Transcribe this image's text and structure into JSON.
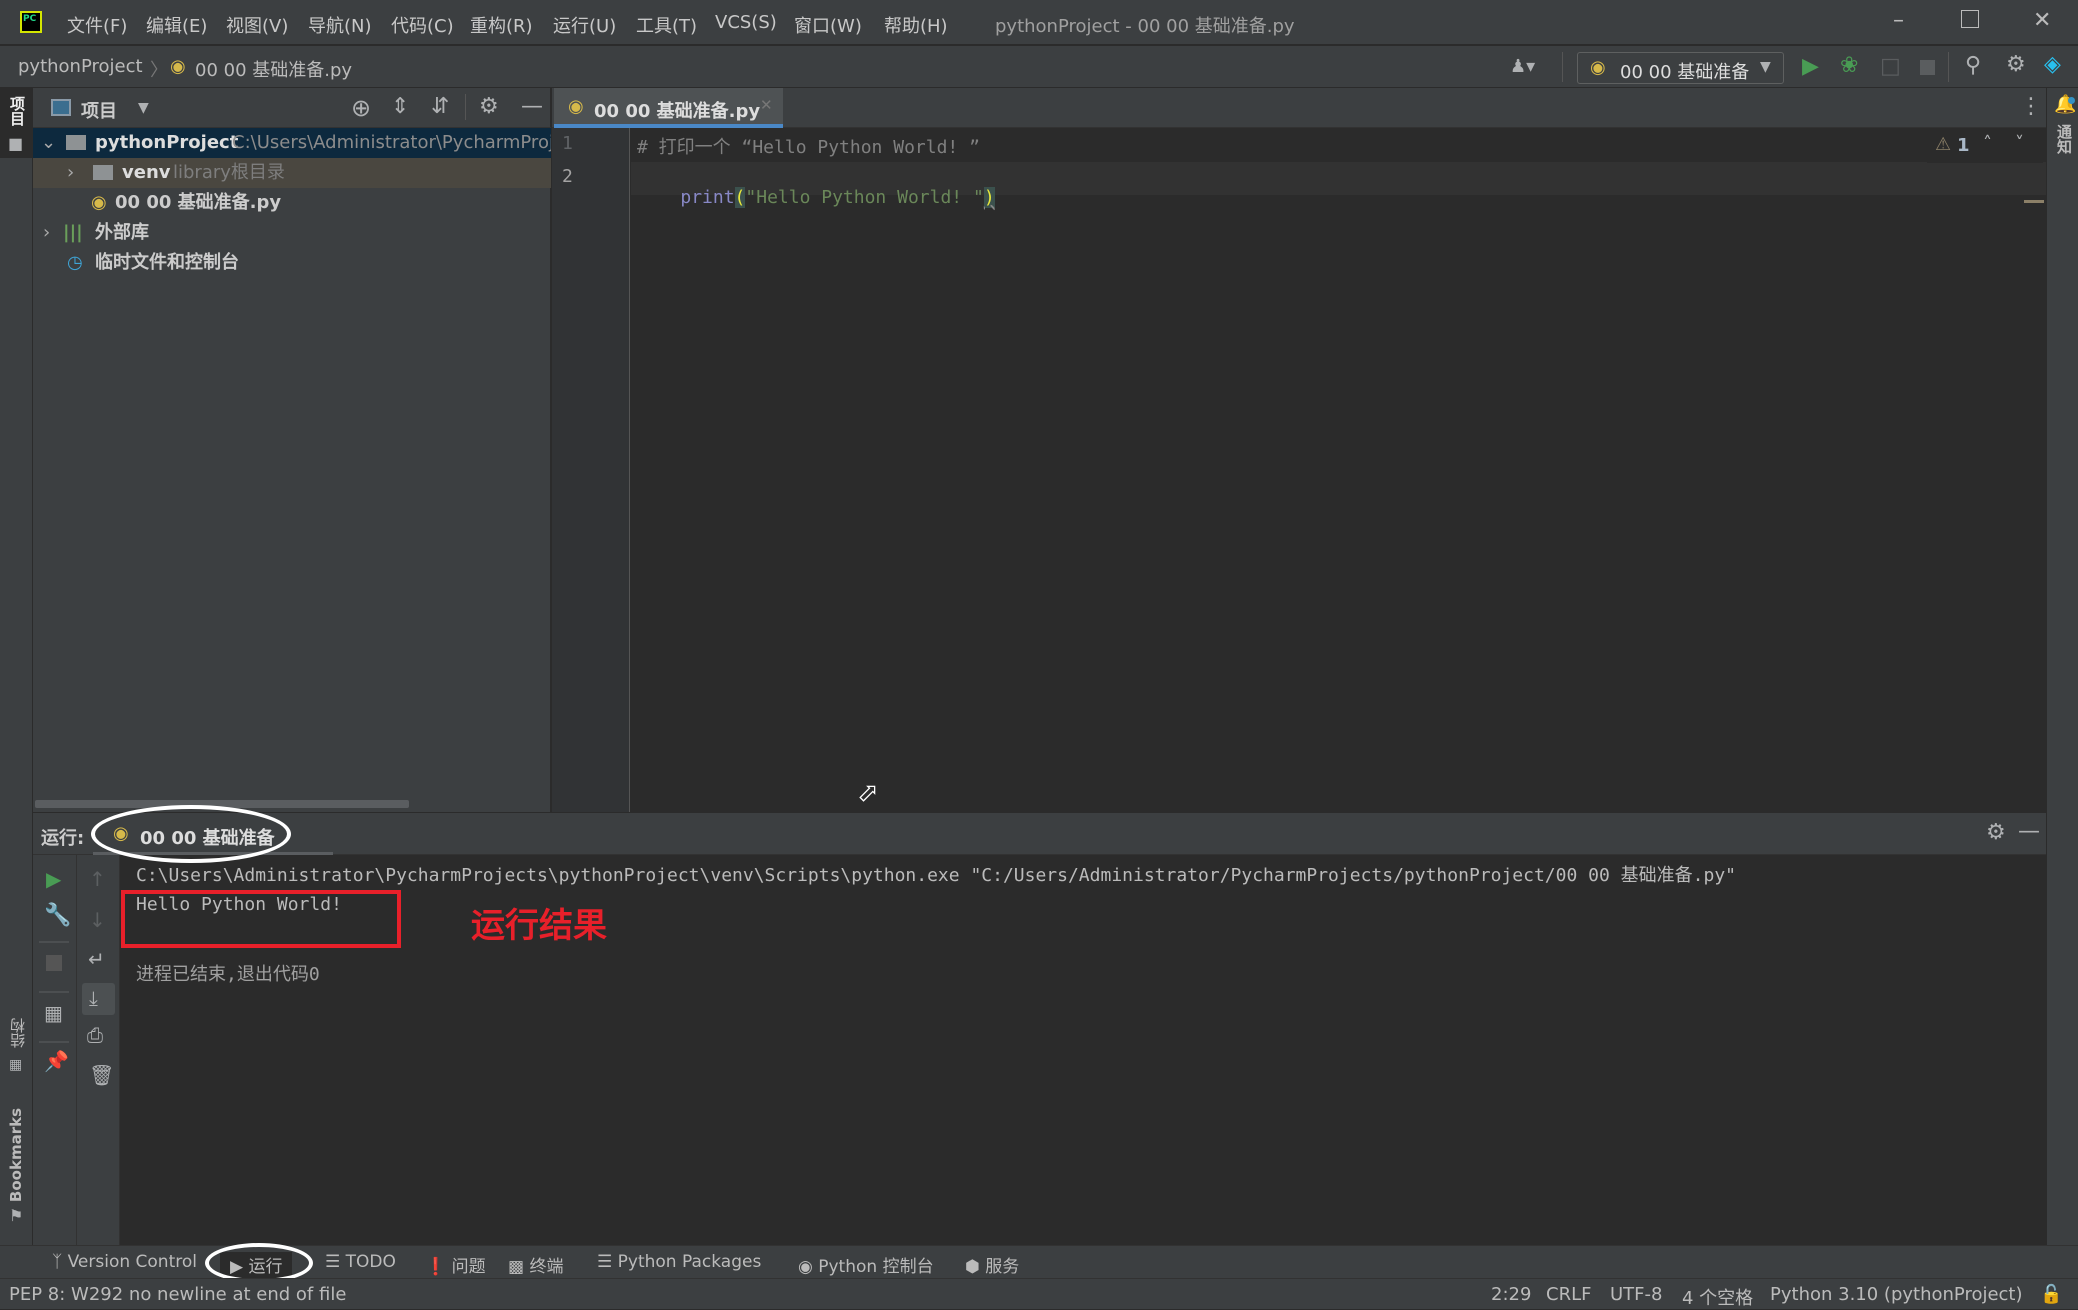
{
  "window": {
    "title": "pythonProject - 00 00 基础准备.py",
    "logo": "PC"
  },
  "menu": [
    "文件(F)",
    "编辑(E)",
    "视图(V)",
    "导航(N)",
    "代码(C)",
    "重构(R)",
    "运行(U)",
    "工具(T)",
    "VCS(S)",
    "窗口(W)",
    "帮助(H)"
  ],
  "breadcrumb": {
    "project": "pythonProject",
    "file": "00 00 基础准备.py"
  },
  "toolbar": {
    "run_config": "00 00 基础准备"
  },
  "left_stripe": {
    "project": "项目",
    "structure": "结构",
    "bookmarks": "Bookmarks"
  },
  "right_stripe": {
    "notifications": "通知"
  },
  "project_panel": {
    "title": "项目",
    "tree": [
      {
        "name": "pythonProject",
        "detail": "C:\\Users\\Administrator\\PycharmProjects\\pythonProject"
      },
      {
        "name": "venv",
        "detail": "library根目录"
      },
      {
        "name": "00 00 基础准备.py",
        "detail": ""
      },
      {
        "name": "外部库",
        "detail": ""
      },
      {
        "name": "临时文件和控制台",
        "detail": ""
      }
    ]
  },
  "editor": {
    "tab": "00 00 基础准备.py",
    "line_numbers": [
      "1",
      "2"
    ],
    "line1_comment": "# 打印一个 “Hello Python World! ”",
    "line2_func": "print",
    "line2_open": "(",
    "line2_string": "\"Hello Python World! \"",
    "line2_close": ")",
    "warnings_count": "1"
  },
  "run_panel": {
    "label": "运行:",
    "tab": "00 00 基础准备",
    "command": "C:\\Users\\Administrator\\PycharmProjects\\pythonProject\\venv\\Scripts\\python.exe \"C:/Users/Administrator/PycharmProjects/pythonProject/00 00 基础准备.py\"",
    "output": "Hello Python World!",
    "exit": "进程已结束,退出代码0",
    "annotation": "运行结果",
    "annotation_color": "#e8202a"
  },
  "bottom_tabs": [
    "Version Control",
    "运行",
    "TODO",
    "问题",
    "终端",
    "Python Packages",
    "Python 控制台",
    "服务"
  ],
  "status": {
    "message": "PEP 8: W292 no newline at end of file",
    "position": "2:29",
    "line_sep": "CRLF",
    "encoding": "UTF-8",
    "indent": "4 个空格",
    "interpreter": "Python 3.10 (pythonProject)"
  }
}
